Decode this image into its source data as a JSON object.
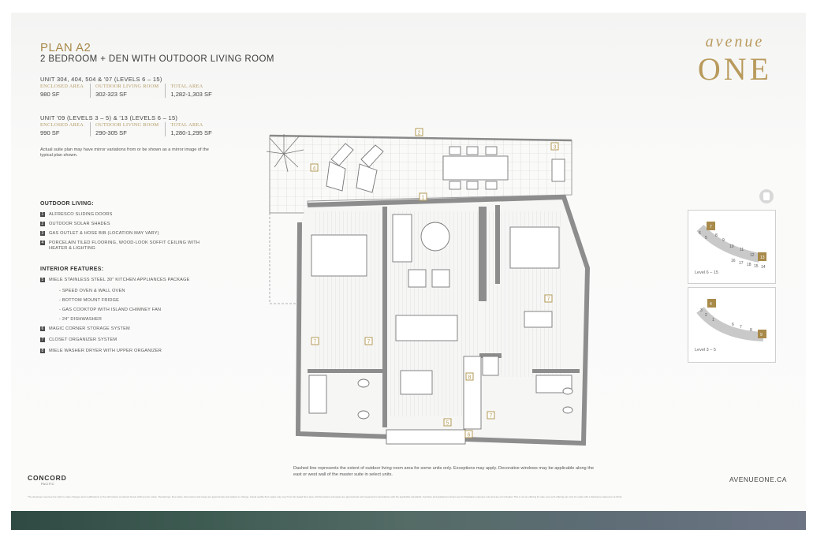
{
  "plan": {
    "title": "PLAN A2",
    "subtitle": "2 BEDROOM + DEN WITH OUTDOOR LIVING ROOM"
  },
  "units": [
    {
      "heading": "UNIT 304, 404, 504 & '07 (LEVELS 6 – 15)",
      "areas": [
        {
          "label": "ENCLOSED AREA",
          "value": "980 SF"
        },
        {
          "label": "OUTDOOR LIVING ROOM",
          "value": "302-323 SF"
        },
        {
          "label": "TOTAL AREA",
          "value": "1,282-1,303 SF"
        }
      ]
    },
    {
      "heading": "UNIT '09 (LEVELS 3 – 5) & '13 (LEVELS 6 – 15)",
      "areas": [
        {
          "label": "ENCLOSED AREA",
          "value": "990 SF"
        },
        {
          "label": "OUTDOOR LIVING ROOM",
          "value": "290-305 SF"
        },
        {
          "label": "TOTAL AREA",
          "value": "1,280-1,295 SF"
        }
      ]
    }
  ],
  "disclaimer_top": "Actual suite plan may have mirror variations from or be shown as a mirror image of the typical plan shown.",
  "outdoor_living": {
    "heading": "OUTDOOR LIVING:",
    "items": [
      {
        "num": "1",
        "text": "ALFRESCO SLIDING DOORS"
      },
      {
        "num": "2",
        "text": "OUTDOOR SOLAR SHADES"
      },
      {
        "num": "3",
        "text": "GAS OUTLET & HOSE BIB (LOCATION MAY VARY)"
      },
      {
        "num": "4",
        "text": "PORCELAIN TILED FLOORING, WOOD-LOOK SOFFIT CEILING WITH HEATER & LIGHTING"
      }
    ]
  },
  "interior_features": {
    "heading": "INTERIOR FEATURES:",
    "item5": {
      "num": "5",
      "text": "MIELE STAINLESS STEEL 30\" KITCHEN APPLIANCES PACKAGE"
    },
    "subitems": [
      "- SPEED OVEN & WALL OVEN",
      "- BOTTOM MOUNT FRIDGE",
      "- GAS COOKTOP WITH ISLAND CHIMNEY FAN",
      "- 24\" DISHWASHER"
    ],
    "items_after": [
      {
        "num": "6",
        "text": "MAGIC CORNER STORAGE SYSTEM"
      },
      {
        "num": "7",
        "text": "CLOSET ORGANIZER SYSTEM"
      },
      {
        "num": "8",
        "text": "MIELE WASHER DRYER WITH UPPER ORGANIZER"
      }
    ]
  },
  "logo": {
    "script": "avenue",
    "word": "ONE"
  },
  "keyplans": [
    {
      "label": "Level 6 – 15",
      "numbers": [
        "7",
        "6",
        "5",
        "8",
        "9",
        "10",
        "11",
        "12",
        "13",
        "15",
        "14",
        "16",
        "17",
        "18",
        "15",
        "14"
      ]
    },
    {
      "label": "Level 3 – 5",
      "numbers": [
        "4",
        "3",
        "2",
        "1",
        "6",
        "7",
        "8",
        "9"
      ]
    }
  ],
  "plan_markers": [
    "1",
    "2",
    "3",
    "4",
    "5",
    "6",
    "7",
    "8"
  ],
  "plan_note": "Dashed line represents the extent of outdoor living room area for some units only. Exceptions may apply. Decorative windows may be applicable along the east or west wall of the master suite in select units.",
  "footer": {
    "brand": "CONCORD",
    "brand_sub": "PACIFIC",
    "website": "AVENUEONE.CA",
    "fineprint": "The developer reserves the right to make changes and modifications to the information contained herein without prior notice. Renderings, floor plans, dimensions and areas are approximate and subject to change. Actual usable floor space may vary from the stated floor area. All dimensions and areas are approximate and measured in accordance with the applicable standards. Furniture and appliances shown are for illustration purposes only and are not included. This is not an offering for sale; any such offering can only be made with a disclosure statement. E.&O.E."
  },
  "colors": {
    "accent_gold": "#a88a4a",
    "marker_gold": "#b39a55",
    "wall": "#8d8d8d",
    "band": "#3f5c53"
  }
}
